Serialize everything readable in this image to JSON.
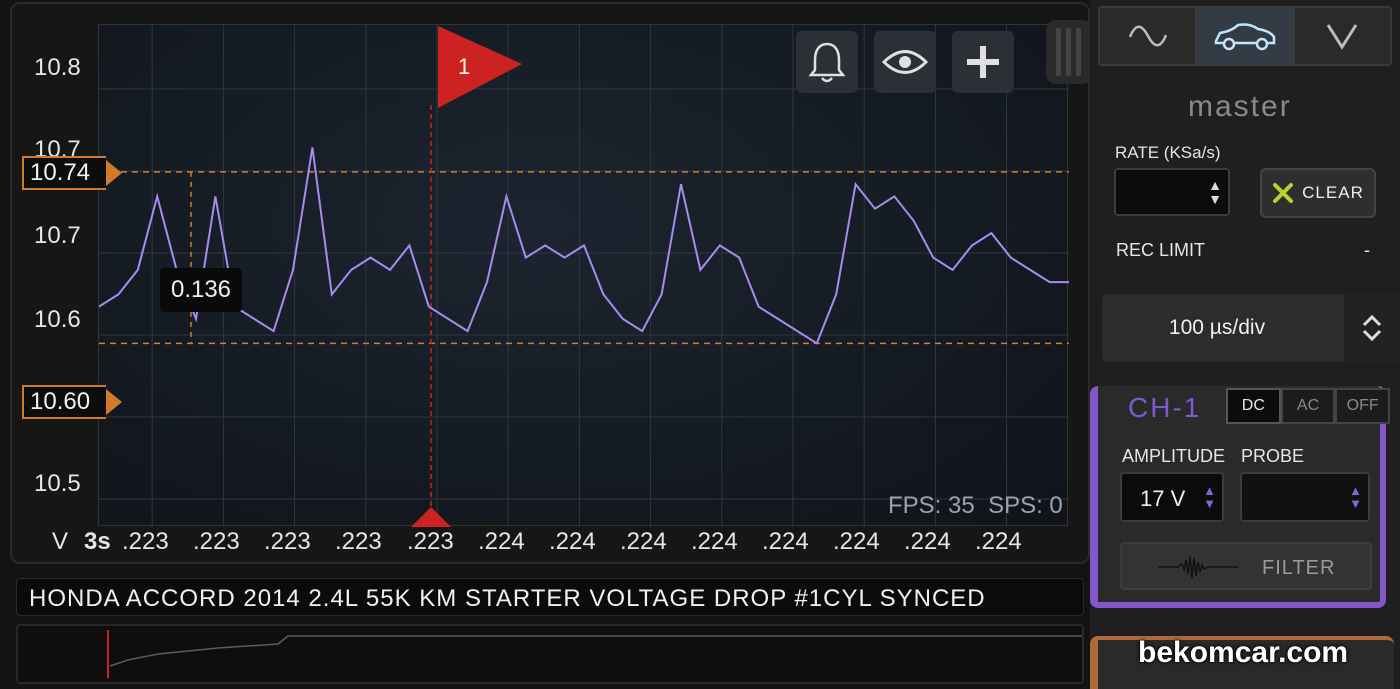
{
  "plot": {
    "y_ticks": [
      "10.8",
      "10.7",
      "10.7",
      "10.6",
      "10.5"
    ],
    "x_unit": "V",
    "x_scale": "3s",
    "x_ticks": [
      ".223",
      ".223",
      ".223",
      ".223",
      ".223",
      ".224",
      ".224",
      ".224",
      ".224",
      ".224",
      ".224",
      ".224",
      ".224"
    ],
    "ylim": [
      10.45,
      10.86
    ],
    "line_color": "#a88bef",
    "cursor_color": "#d08030",
    "trigger_color": "#cc2222"
  },
  "markers": {
    "upper": "10.74",
    "lower": "10.60",
    "delta": "0.136"
  },
  "trigger": {
    "label": "1"
  },
  "toolbar": {
    "bell": "bell-icon",
    "eye": "eye-icon",
    "plus": "plus-icon"
  },
  "status": {
    "fps": "FPS: 35",
    "sps": "SPS: 0"
  },
  "caption": "HONDA ACCORD 2014 2.4L 55K KM STARTER VOLTAGE DROP #1CYL SYNCED",
  "panel": {
    "mode_icons": [
      "sine-wave-icon",
      "car-icon",
      "chevron-down-icon"
    ],
    "master": "master",
    "rate_label": "RATE (KSa/s)",
    "rate_value": "",
    "clear": "CLEAR",
    "rec_label": "REC LIMIT",
    "rec_value": "-",
    "timebase": "100 µs/div"
  },
  "ch1": {
    "title": "CH-1",
    "coupling": [
      "DC",
      "AC",
      "OFF"
    ],
    "selected_coupling": "DC",
    "amplitude_label": "AMPLITUDE",
    "probe_label": "PROBE",
    "amplitude": "17 V",
    "probe": "",
    "filter": "FILTER",
    "color": "#8257c9"
  },
  "watermark": "bekomcar.com",
  "chart_data": {
    "type": "line",
    "title": "",
    "xlabel": "",
    "ylabel": "V",
    "ylim": [
      10.45,
      10.86
    ],
    "grid": true,
    "series": [
      {
        "x": [
          0,
          0.02,
          0.04,
          0.06,
          0.08,
          0.1,
          0.12,
          0.14,
          0.16,
          0.18,
          0.2,
          0.22,
          0.24,
          0.26,
          0.28,
          0.3,
          0.32,
          0.34,
          0.36,
          0.38,
          0.4,
          0.42,
          0.44,
          0.46,
          0.48,
          0.5,
          0.52,
          0.54,
          0.56,
          0.58,
          0.6,
          0.62,
          0.64,
          0.66,
          0.68,
          0.7,
          0.72,
          0.74,
          0.76,
          0.78,
          0.8,
          0.82,
          0.84,
          0.86,
          0.88,
          0.9,
          0.92,
          0.94,
          0.96,
          0.98,
          1.0
        ],
        "values": [
          10.63,
          10.64,
          10.66,
          10.72,
          10.66,
          10.62,
          10.72,
          10.63,
          10.62,
          10.61,
          10.66,
          10.76,
          10.64,
          10.66,
          10.67,
          10.66,
          10.68,
          10.63,
          10.62,
          10.61,
          10.65,
          10.72,
          10.67,
          10.68,
          10.67,
          10.68,
          10.64,
          10.62,
          10.61,
          10.64,
          10.73,
          10.66,
          10.68,
          10.67,
          10.63,
          10.62,
          10.61,
          10.6,
          10.64,
          10.73,
          10.71,
          10.72,
          10.7,
          10.67,
          10.66,
          10.68,
          10.69,
          10.67,
          10.66,
          10.65,
          10.65
        ]
      }
    ]
  }
}
